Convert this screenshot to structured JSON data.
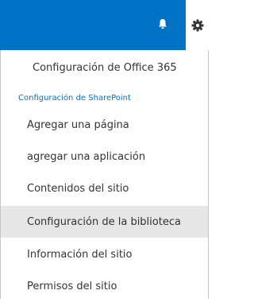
{
  "header": {
    "notifications_icon": "bell-icon",
    "settings_icon": "gear-icon",
    "bar_color": "#0072c6",
    "accent_color": "#0072c6"
  },
  "menu": {
    "office365_settings": "Configuración de Office 365",
    "sharepoint_section_title": "Configuración de SharePoint",
    "items": [
      {
        "label": "Agregar una página"
      },
      {
        "label": "agregar una aplicación"
      },
      {
        "label": "Contenidos del sitio"
      },
      {
        "label": "Configuración de la biblioteca",
        "highlighted": true
      },
      {
        "label": "Información del sitio"
      },
      {
        "label": "Permisos del sitio"
      }
    ]
  }
}
